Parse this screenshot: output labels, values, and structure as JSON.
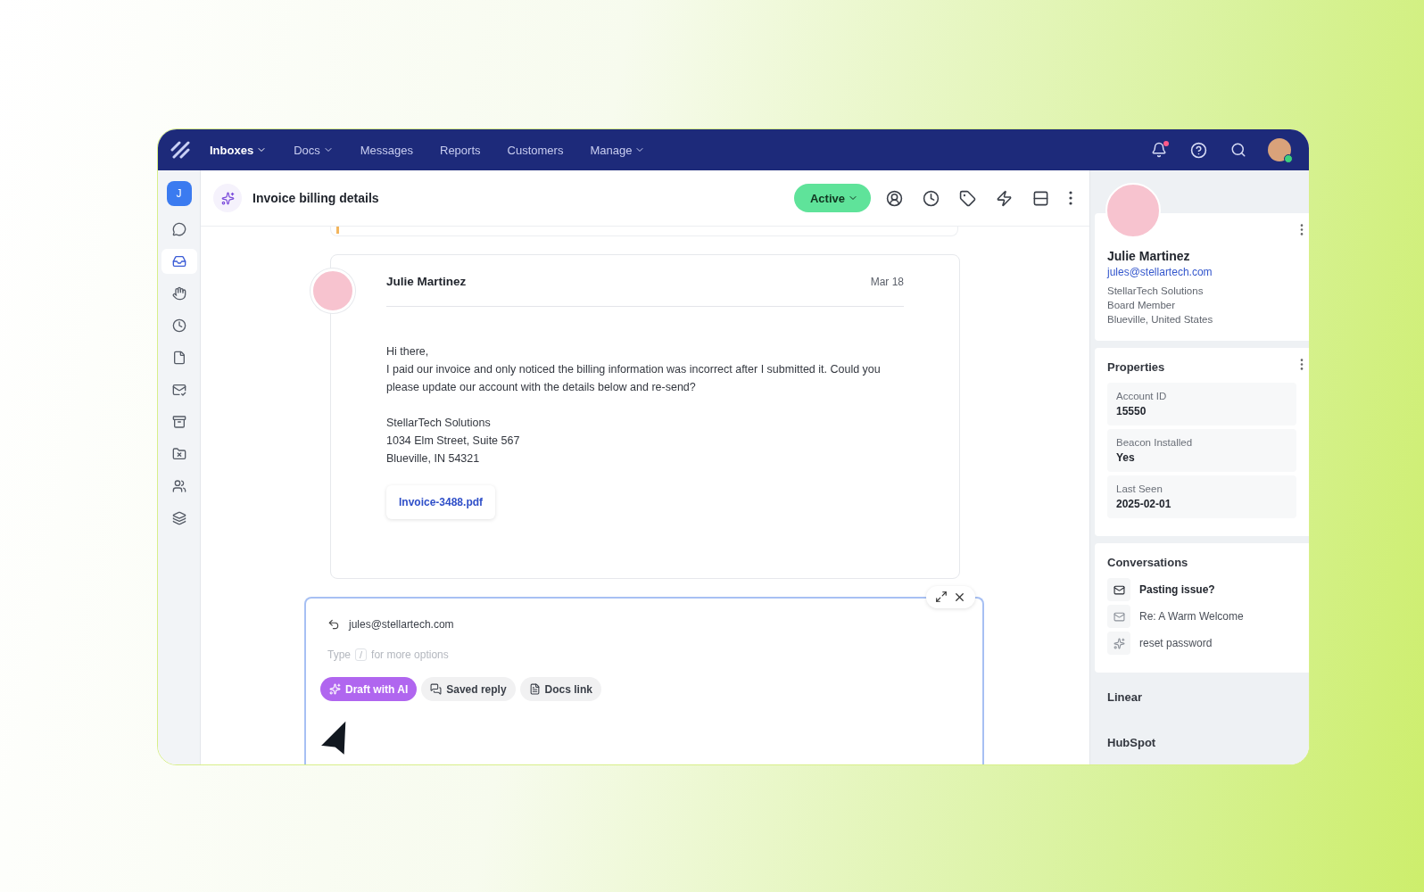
{
  "nav": [
    {
      "label": "Inboxes",
      "caret": true,
      "selected": true
    },
    {
      "label": "Docs",
      "caret": true,
      "selected": false
    },
    {
      "label": "Messages",
      "caret": false,
      "selected": false
    },
    {
      "label": "Reports",
      "caret": false,
      "selected": false
    },
    {
      "label": "Customers",
      "caret": false,
      "selected": false
    },
    {
      "label": "Manage",
      "caret": true,
      "selected": false
    }
  ],
  "notifications": {
    "unread": true
  },
  "user": {
    "online": true
  },
  "rail": {
    "initial": "J",
    "items": [
      {
        "selected": false
      },
      {
        "selected": true
      },
      {
        "selected": false
      },
      {
        "selected": false
      },
      {
        "selected": false
      },
      {
        "selected": false
      },
      {
        "selected": false
      },
      {
        "selected": false
      },
      {
        "selected": false
      },
      {
        "selected": false
      }
    ]
  },
  "conversation": {
    "title": "Invoice billing details",
    "status": "Active"
  },
  "message": {
    "sender": "Julie Martinez",
    "date": "Mar 18",
    "body": [
      "Hi there,",
      "I paid our invoice and only noticed the billing information was  incorrect after I submitted it. Could you please update our account with the details below and re-send?"
    ],
    "signature": [
      "StellarTech Solutions",
      "1034 Elm Street, Suite 567",
      "Blueville, IN 54321"
    ],
    "attachment": "Invoice-3488.pdf"
  },
  "composer": {
    "to": "jules@stellartech.com",
    "placeholder_before": "Type",
    "placeholder_key": "/",
    "placeholder_after": "for more options",
    "actions": [
      {
        "label": "Draft with AI",
        "kind": "ai"
      },
      {
        "label": "Saved reply",
        "kind": "saved"
      },
      {
        "label": "Docs link",
        "kind": "docs"
      }
    ]
  },
  "customer": {
    "name": "Julie Martinez",
    "email": "jules@stellartech.com",
    "details": [
      "StellarTech Solutions",
      "Board Member",
      "Blueville, United States"
    ]
  },
  "properties": {
    "title": "Properties",
    "items": [
      {
        "label": "Account ID",
        "value": "15550"
      },
      {
        "label": "Beacon Installed",
        "value": "Yes"
      },
      {
        "label": "Last Seen",
        "value": "2025-02-01"
      }
    ]
  },
  "conversations": {
    "title": "Conversations",
    "items": [
      {
        "label": "Pasting issue?",
        "kind": "mail",
        "unread": true
      },
      {
        "label": "Re: A Warm Welcome",
        "kind": "mail",
        "unread": false
      },
      {
        "label": "reset password",
        "kind": "ai",
        "unread": false
      }
    ]
  },
  "integrations": [
    "Linear",
    "HubSpot"
  ]
}
